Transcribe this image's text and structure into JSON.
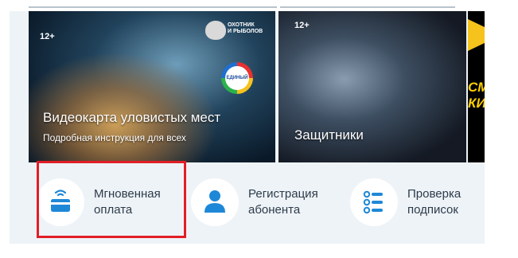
{
  "banners": [
    {
      "age": "12+",
      "title": "Видеокарта уловистых мест",
      "subtitle": "Подробная инструкция для всех",
      "channel_logo_text": [
        "ОХОТНИК",
        "И РЫБОЛОВ"
      ],
      "badge_text": "ЕДИНЫЙ"
    },
    {
      "age": "12+",
      "title": "Защитники"
    },
    {
      "title_lines": [
        "СМОТ",
        "КИНОЗА"
      ]
    }
  ],
  "actions": [
    {
      "label_lines": [
        "Мгновенная",
        "оплата"
      ],
      "icon": "card-payment-icon"
    },
    {
      "label_lines": [
        "Регистрация",
        "абонента"
      ],
      "icon": "user-icon"
    },
    {
      "label_lines": [
        "Проверка",
        "подписок"
      ],
      "icon": "list-icon"
    }
  ],
  "colors": {
    "accent": "#1e88d8",
    "highlight": "#e11e26",
    "text": "#2d3b4a",
    "background": "#eef3f7"
  }
}
